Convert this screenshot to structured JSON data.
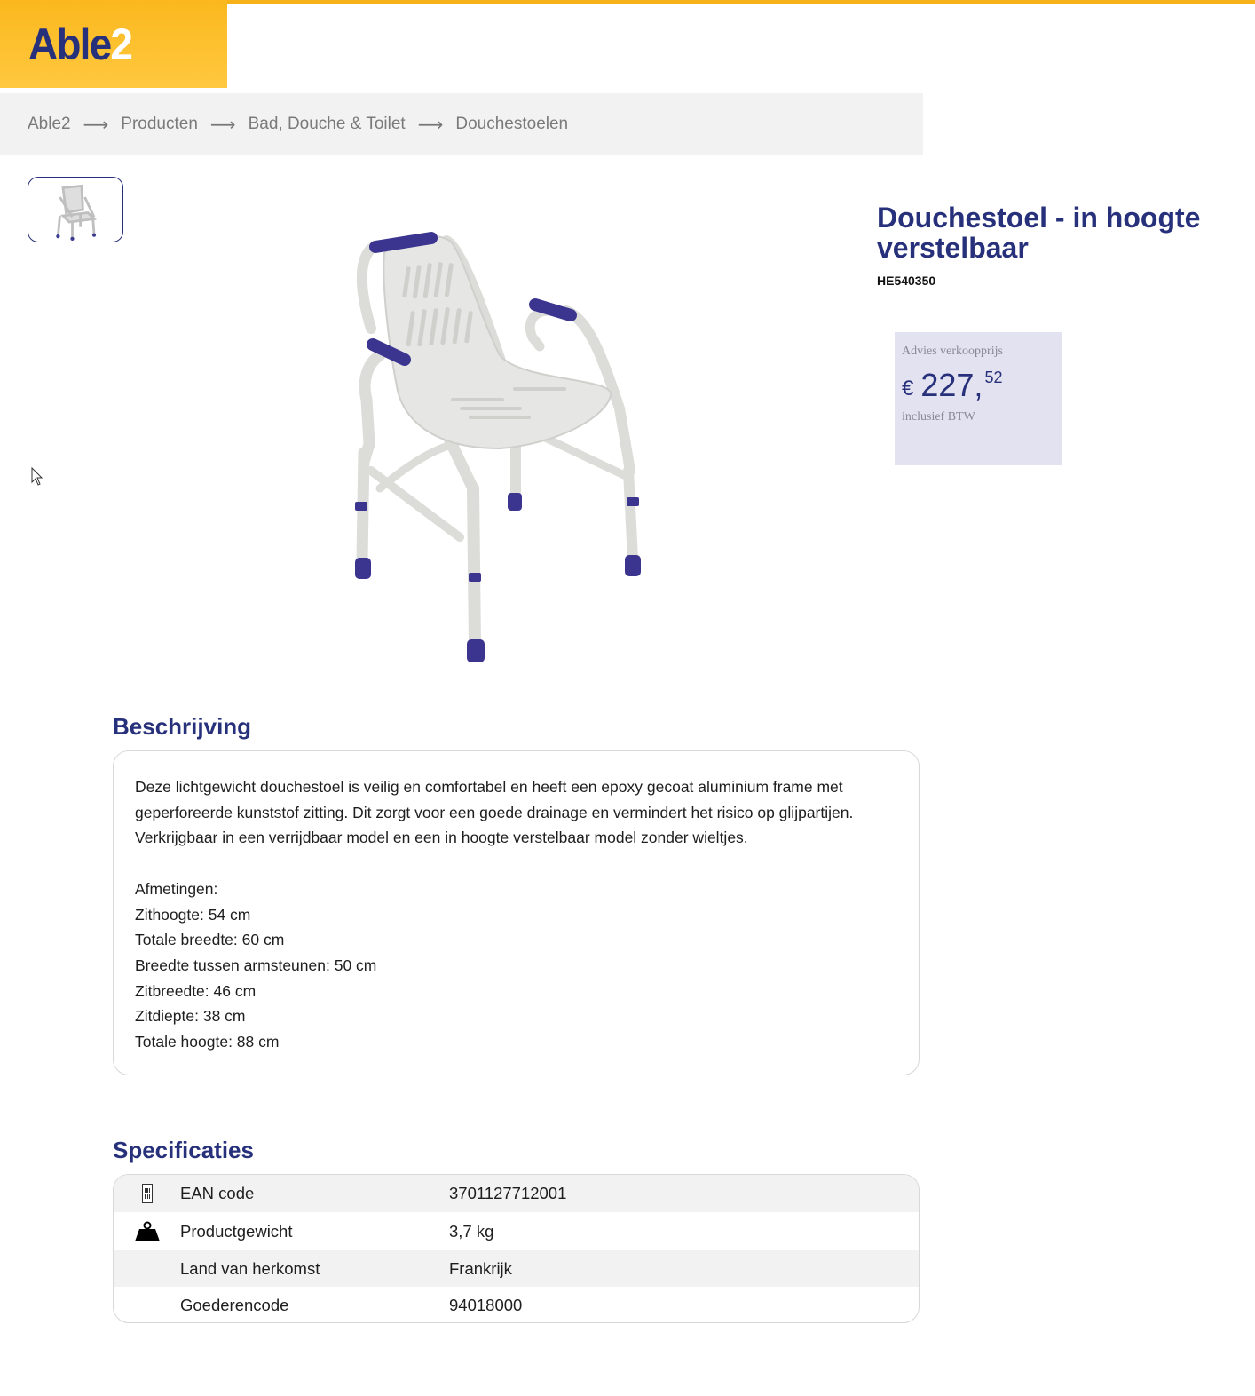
{
  "brand": {
    "name": "Able",
    "number": "2"
  },
  "breadcrumb": [
    "Able2",
    "Producten",
    "Bad, Douche & Toilet",
    "Douchestoelen"
  ],
  "product": {
    "title": "Douchestoel - in hoogte verstelbaar",
    "sku": "HE540350",
    "image_icon": "shower-chair-image"
  },
  "price": {
    "label": "Advies verkoopprijs",
    "currency": "€",
    "integer": "227,",
    "decimals": "52",
    "note": "inclusief BTW"
  },
  "description": {
    "title": "Beschrijving",
    "intro": "Deze lichtgewicht douchestoel is veilig en comfortabel en heeft een epoxy gecoat aluminium frame met geperforeerde kunststof zitting. Dit zorgt voor een goede drainage en vermindert het risico op glijpartijen. Verkrijgbaar in een verrijdbaar model en een in hoogte verstelbaar model zonder wieltjes.",
    "lines": [
      "Afmetingen:",
      "Zithoogte: 54 cm",
      "Totale breedte: 60 cm",
      "Breedte tussen armsteunen: 50 cm",
      "Zitbreedte: 46 cm",
      "Zitdiepte: 38 cm",
      "Totale hoogte: 88 cm"
    ]
  },
  "specifications": {
    "title": "Specificaties",
    "rows": [
      {
        "icon": "barcode-icon",
        "name": "EAN code",
        "value": "3701127712001"
      },
      {
        "icon": "weight-icon",
        "name": "Productgewicht",
        "value": "3,7 kg"
      },
      {
        "icon": "",
        "name": "Land van herkomst",
        "value": "Frankrijk"
      },
      {
        "icon": "",
        "name": "Goederencode",
        "value": "94018000"
      }
    ]
  },
  "colors": {
    "accent": "#27307a",
    "brand_yellow": "#fbb81e",
    "price_bg": "#e2e2f1"
  }
}
